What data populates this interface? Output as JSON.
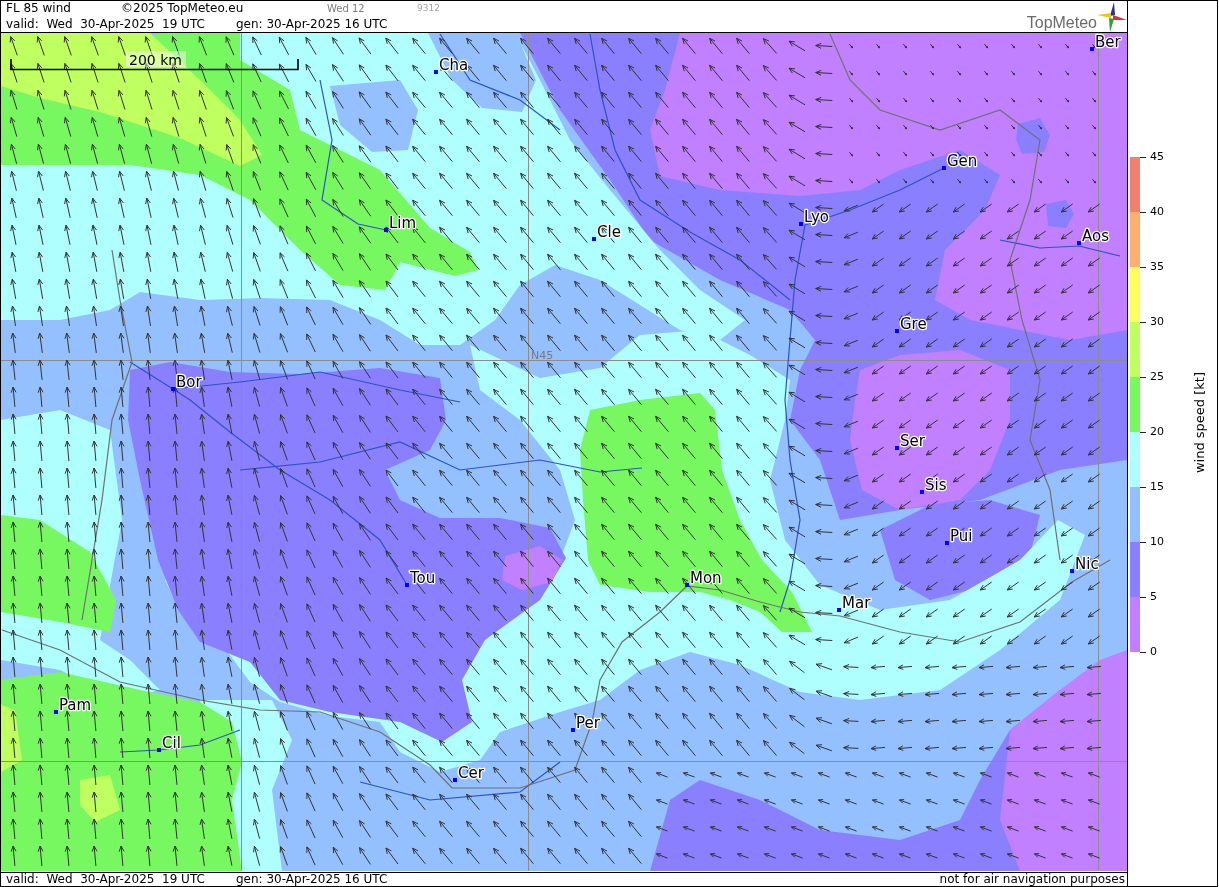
{
  "header": {
    "title": "FL 85 wind",
    "copyright": "©2025 TopMeteo.eu",
    "day_code": "Wed 12",
    "run_code": "9312",
    "valid": "valid:  Wed  30-Apr-2025  19 UTC",
    "generated": "gen: 30-Apr-2025 16 UTC",
    "logo": "TopMeteo"
  },
  "map": {
    "scale_label": "200 km",
    "grid_label": "N45",
    "cities": [
      "Ber",
      "Cha",
      "Gen",
      "Lyo",
      "Lim",
      "Cle",
      "Aos",
      "Gre",
      "Bor",
      "Ser",
      "Sis",
      "Pui",
      "Nic",
      "Tou",
      "Mon",
      "Mar",
      "Pam",
      "Per",
      "Cil",
      "Cer"
    ]
  },
  "legend": {
    "title": "wind speed [kt]",
    "ticks": [
      "45",
      "40",
      "35",
      "30",
      "25",
      "20",
      "15",
      "10",
      "5",
      "0"
    ],
    "bands": [
      {
        "color": "#f08070"
      },
      {
        "color": "#ffb070"
      },
      {
        "color": "#ffff60"
      },
      {
        "color": "#c0ff60"
      },
      {
        "color": "#78f860"
      },
      {
        "color": "#b0ffff"
      },
      {
        "color": "#94c0ff"
      },
      {
        "color": "#8a80ff"
      },
      {
        "color": "#c080ff"
      }
    ]
  },
  "footer": {
    "valid": "valid:  Wed  30-Apr-2025  19 UTC",
    "generated": "gen: 30-Apr-2025 16 UTC",
    "disclaimer": "not for air navigation purposes"
  }
}
